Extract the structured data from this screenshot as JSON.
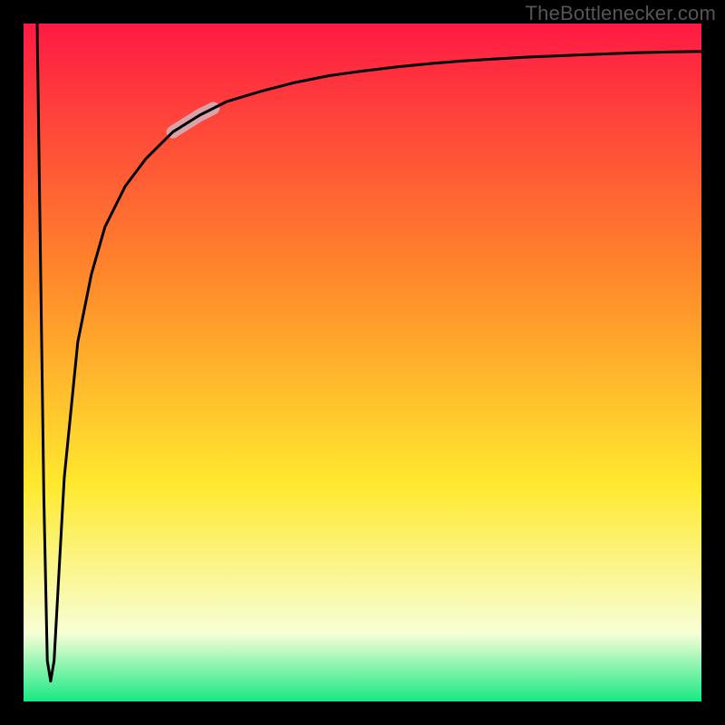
{
  "watermark": "TheBottlenecker.com",
  "colors": {
    "frame": "#000000",
    "gradient_top": "#ff1a44",
    "gradient_mid1": "#ff8a2a",
    "gradient_mid2": "#ffe92e",
    "gradient_low": "#f7ffd6",
    "gradient_bottom": "#17e884",
    "curve": "#000000",
    "highlight": "#d9a3aa"
  },
  "chart_data": {
    "type": "line",
    "title": "",
    "xlabel": "",
    "ylabel": "",
    "xlim": [
      0,
      100
    ],
    "ylim": [
      0,
      100
    ],
    "x": [
      2,
      3,
      3.5,
      4,
      4.5,
      5,
      6,
      8,
      10,
      12,
      15,
      18,
      22,
      26,
      30,
      35,
      40,
      45,
      50,
      55,
      60,
      65,
      70,
      75,
      80,
      85,
      90,
      95,
      100
    ],
    "values": [
      100,
      30,
      6,
      3,
      6,
      15,
      33,
      53,
      63,
      70,
      76,
      80,
      84,
      86.5,
      88.5,
      90,
      91.3,
      92.3,
      93,
      93.6,
      94.1,
      94.5,
      94.8,
      95.1,
      95.3,
      95.5,
      95.7,
      95.8,
      95.9
    ],
    "highlight_segment": {
      "x_from": 22,
      "x_to": 28
    },
    "annotations": []
  }
}
